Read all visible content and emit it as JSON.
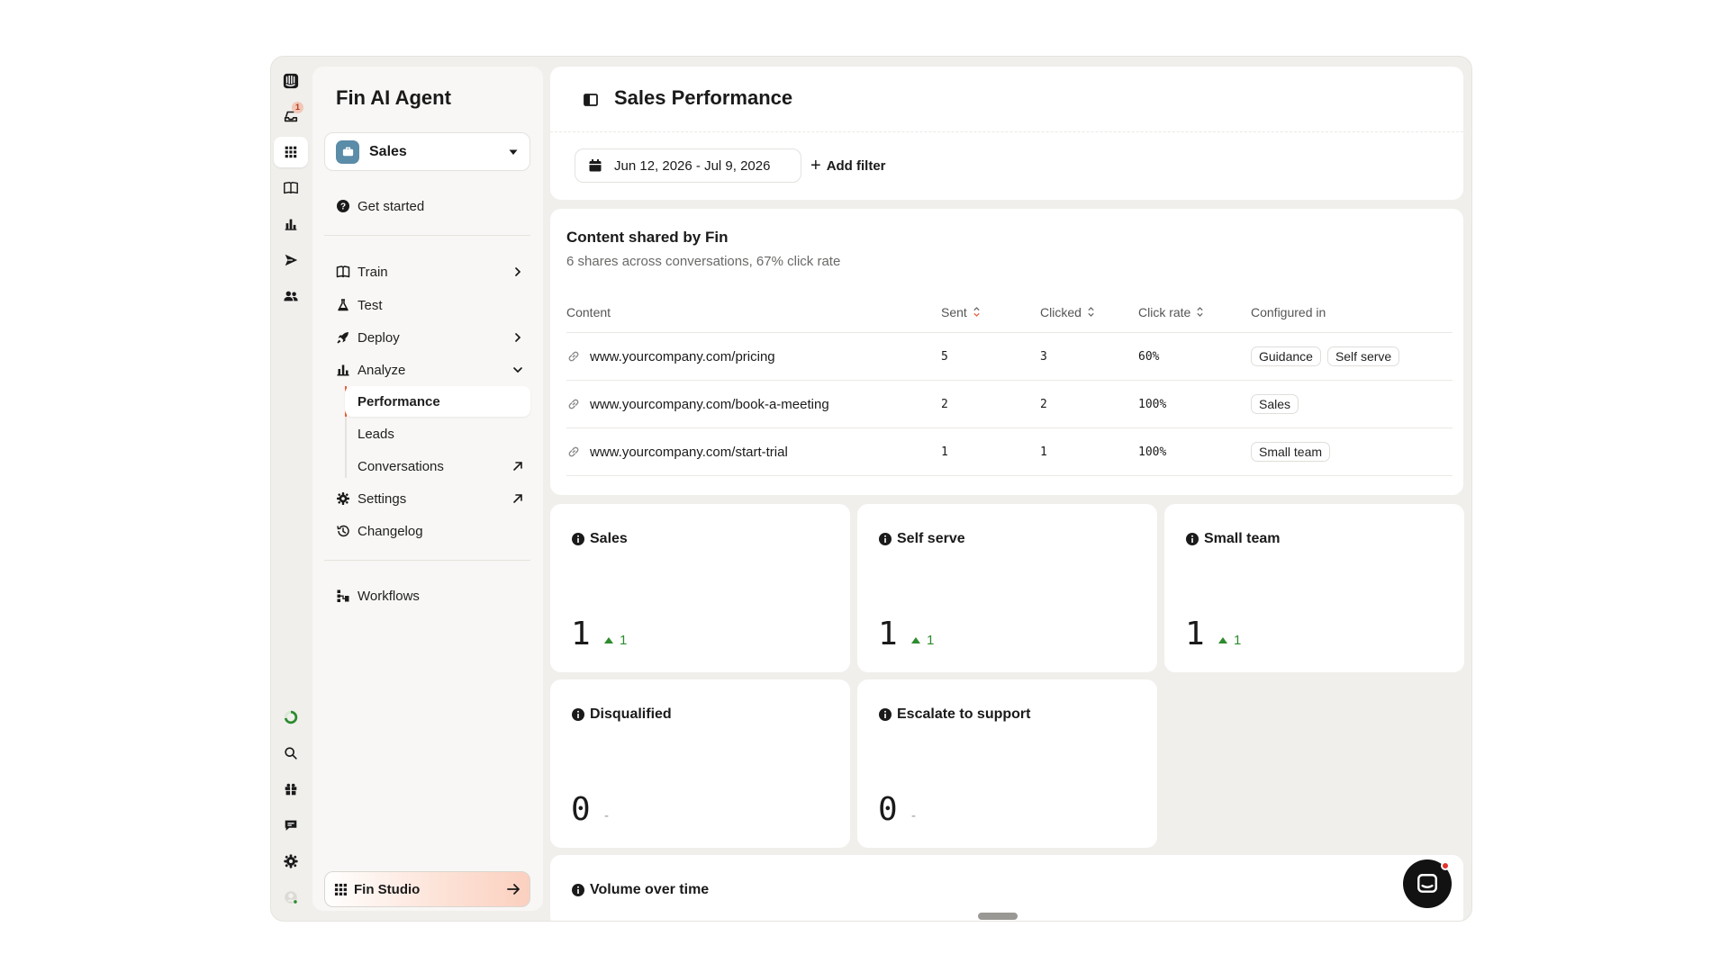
{
  "rail": {
    "inbox_badge": "1"
  },
  "sidebar": {
    "title": "Fin AI Agent",
    "workspace": "Sales",
    "get_started": "Get started",
    "train": "Train",
    "test": "Test",
    "deploy": "Deploy",
    "analyze": "Analyze",
    "analyze_sub": {
      "performance": "Performance",
      "leads": "Leads",
      "conversations": "Conversations"
    },
    "settings": "Settings",
    "changelog": "Changelog",
    "workflows": "Workflows",
    "studio": "Fin Studio"
  },
  "header": {
    "title": "Sales Performance",
    "date_range": "Jun 12, 2026 - Jul 9, 2026",
    "add_filter": "Add filter"
  },
  "content_shared": {
    "title": "Content shared by Fin",
    "subtitle": "6 shares across conversations, 67% click rate",
    "columns": {
      "content": "Content",
      "sent": "Sent",
      "clicked": "Clicked",
      "click_rate": "Click rate",
      "configured_in": "Configured in"
    },
    "rows": [
      {
        "content": "www.yourcompany.com/pricing",
        "sent": "5",
        "clicked": "3",
        "click_rate": "60%",
        "tags": [
          "Guidance",
          "Self serve"
        ]
      },
      {
        "content": "www.yourcompany.com/book-a-meeting",
        "sent": "2",
        "clicked": "2",
        "click_rate": "100%",
        "tags": [
          "Sales"
        ]
      },
      {
        "content": "www.yourcompany.com/start-trial",
        "sent": "1",
        "clicked": "1",
        "click_rate": "100%",
        "tags": [
          "Small team"
        ]
      }
    ]
  },
  "stats": [
    {
      "title": "Sales",
      "value": "1",
      "delta": "1"
    },
    {
      "title": "Self serve",
      "value": "1",
      "delta": "1"
    },
    {
      "title": "Small team",
      "value": "1",
      "delta": "1"
    },
    {
      "title": "Disqualified",
      "value": "0",
      "delta": "-"
    },
    {
      "title": "Escalate to support",
      "value": "0",
      "delta": "-"
    }
  ],
  "volume": {
    "title": "Volume over time"
  },
  "colors": {
    "accent": "#e8603c",
    "positive": "#2e8b2e",
    "workspace_icon": "#5b8ca8"
  }
}
